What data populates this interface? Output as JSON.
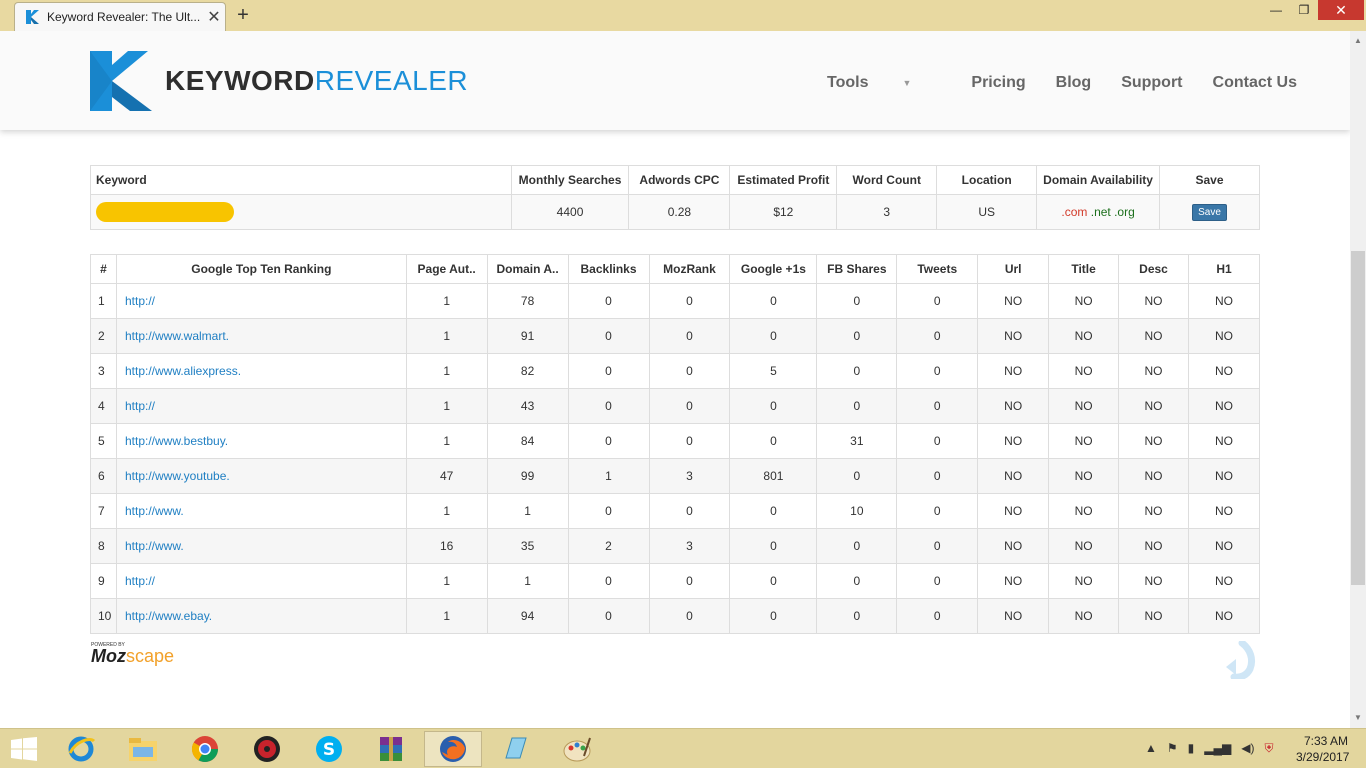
{
  "browser": {
    "tab_title": "Keyword Revealer: The Ult...",
    "new_tab": "+",
    "close_tab": "✕",
    "minimize": "—",
    "restore": "❐",
    "close_window": "✕"
  },
  "header": {
    "logo_keyword": "KEYWORD",
    "logo_revealer": "REVEALER",
    "nav": [
      "Tools",
      "Pricing",
      "Blog",
      "Support",
      "Contact Us"
    ]
  },
  "keyword_table": {
    "headers": [
      "Keyword",
      "Monthly Searches",
      "Adwords CPC",
      "Estimated Profit",
      "Word Count",
      "Location",
      "Domain Availability",
      "Save"
    ],
    "row": {
      "monthly_searches": "4400",
      "adwords_cpc": "0.28",
      "estimated_profit": "$12",
      "word_count": "3",
      "location": "US",
      "domain_com": ".com",
      "domain_net": ".net",
      "domain_org": ".org",
      "save_label": "Save"
    }
  },
  "ranking_table": {
    "headers": [
      "#",
      "Google Top Ten Ranking",
      "Page Aut..",
      "Domain A..",
      "Backlinks",
      "MozRank",
      "Google +1s",
      "FB Shares",
      "Tweets",
      "Url",
      "Title",
      "Desc",
      "H1"
    ],
    "rows": [
      {
        "n": "1",
        "url": "http://",
        "pa": "1",
        "da": "78",
        "bl": "0",
        "mr": "0",
        "gp": "0",
        "fb": "0",
        "tw": "0",
        "u": "NO",
        "t": "NO",
        "d": "NO",
        "h": "NO"
      },
      {
        "n": "2",
        "url": "http://www.walmart.",
        "pa": "1",
        "da": "91",
        "bl": "0",
        "mr": "0",
        "gp": "0",
        "fb": "0",
        "tw": "0",
        "u": "NO",
        "t": "NO",
        "d": "NO",
        "h": "NO"
      },
      {
        "n": "3",
        "url": "http://www.aliexpress.",
        "pa": "1",
        "da": "82",
        "bl": "0",
        "mr": "0",
        "gp": "5",
        "fb": "0",
        "tw": "0",
        "u": "NO",
        "t": "NO",
        "d": "NO",
        "h": "NO"
      },
      {
        "n": "4",
        "url": "http://",
        "pa": "1",
        "da": "43",
        "bl": "0",
        "mr": "0",
        "gp": "0",
        "fb": "0",
        "tw": "0",
        "u": "NO",
        "t": "NO",
        "d": "NO",
        "h": "NO"
      },
      {
        "n": "5",
        "url": "http://www.bestbuy.",
        "pa": "1",
        "da": "84",
        "bl": "0",
        "mr": "0",
        "gp": "0",
        "fb": "31",
        "tw": "0",
        "u": "NO",
        "t": "NO",
        "d": "NO",
        "h": "NO"
      },
      {
        "n": "6",
        "url": "http://www.youtube.",
        "pa": "47",
        "da": "99",
        "bl": "1",
        "mr": "3",
        "gp": "801",
        "fb": "0",
        "tw": "0",
        "u": "NO",
        "t": "NO",
        "d": "NO",
        "h": "NO"
      },
      {
        "n": "7",
        "url": "http://www.",
        "pa": "1",
        "da": "1",
        "bl": "0",
        "mr": "0",
        "gp": "0",
        "fb": "10",
        "tw": "0",
        "u": "NO",
        "t": "NO",
        "d": "NO",
        "h": "NO"
      },
      {
        "n": "8",
        "url": "http://www.",
        "pa": "16",
        "da": "35",
        "bl": "2",
        "mr": "3",
        "gp": "0",
        "fb": "0",
        "tw": "0",
        "u": "NO",
        "t": "NO",
        "d": "NO",
        "h": "NO"
      },
      {
        "n": "9",
        "url": "http://",
        "pa": "1",
        "da": "1",
        "bl": "0",
        "mr": "0",
        "gp": "0",
        "fb": "0",
        "tw": "0",
        "u": "NO",
        "t": "NO",
        "d": "NO",
        "h": "NO"
      },
      {
        "n": "10",
        "url": "http://www.ebay.",
        "pa": "1",
        "da": "94",
        "bl": "0",
        "mr": "0",
        "gp": "0",
        "fb": "0",
        "tw": "0",
        "u": "NO",
        "t": "NO",
        "d": "NO",
        "h": "NO"
      }
    ]
  },
  "footer": {
    "moz_powered": "POWERED BY",
    "moz_main": "Moz",
    "moz_scape": "scape"
  },
  "taskbar": {
    "apps": [
      "ie-icon",
      "file-explorer-icon",
      "chrome-icon",
      "app-red-icon",
      "skype-icon",
      "winrar-icon",
      "firefox-icon",
      "notepad-icon",
      "paint-icon"
    ],
    "time": "7:33 AM",
    "date": "3/29/2017"
  },
  "colors": {
    "accent": "#1b8fd8",
    "highlight": "#f8c400",
    "link": "#1f7fc3"
  }
}
